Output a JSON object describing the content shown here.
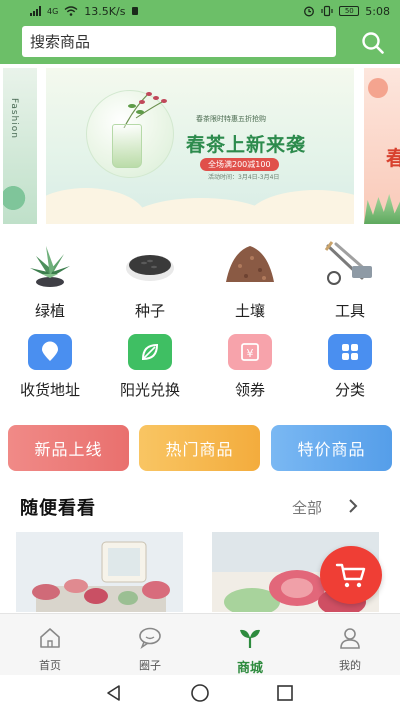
{
  "status_bar": {
    "network": "4G",
    "speed": "13.5K/s",
    "battery": "50",
    "time": "5:08"
  },
  "search": {
    "placeholder": "搜索商品"
  },
  "banner": {
    "left_text": "Fashion",
    "small_text": "春茶限时特惠五折抢购",
    "title": "春茶上新来袭",
    "pill": "全场满200减100",
    "date": "活动时间：3月4日-3月4日",
    "right_char": "春"
  },
  "categories": [
    {
      "label": "绿植",
      "icon": "succulent-plant"
    },
    {
      "label": "种子",
      "icon": "seeds-bowl"
    },
    {
      "label": "土壤",
      "icon": "soil-pile"
    },
    {
      "label": "工具",
      "icon": "garden-tools"
    }
  ],
  "features": [
    {
      "label": "收货地址",
      "icon": "location-pin-icon",
      "color": "#4a8ff0"
    },
    {
      "label": "阳光兑换",
      "icon": "leaf-icon",
      "color": "#3fbf63"
    },
    {
      "label": "领券",
      "icon": "coupon-icon",
      "color": "#f7a3ab"
    },
    {
      "label": "分类",
      "icon": "category-grid-icon",
      "color": "#4a8ff0"
    }
  ],
  "promo_buttons": [
    {
      "label": "新品上线",
      "color": "#ea7270"
    },
    {
      "label": "热门商品",
      "color": "#f6b84e"
    },
    {
      "label": "特价商品",
      "color": "#63aaf0"
    }
  ],
  "section": {
    "title": "随便看看",
    "all_label": "全部"
  },
  "tabs": [
    {
      "label": "首页",
      "icon": "home-icon",
      "active": false
    },
    {
      "label": "圈子",
      "icon": "chat-bubble-icon",
      "active": false
    },
    {
      "label": "商城",
      "icon": "sprout-icon",
      "active": true
    },
    {
      "label": "我的",
      "icon": "user-icon",
      "active": false
    }
  ],
  "colors": {
    "header_green": "#6cbf68",
    "active_green": "#2e8b3e",
    "cart_red": "#ef3e35"
  }
}
